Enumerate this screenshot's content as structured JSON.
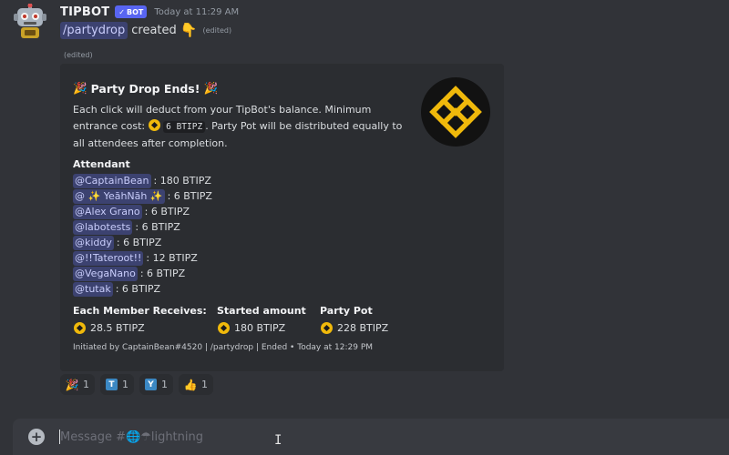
{
  "message": {
    "username": "TIPBOT",
    "bot_tag": "BOT",
    "timestamp": "Today at 11:29 AM",
    "command": "/partydrop",
    "created_text": "created",
    "edited_label": "(edited)"
  },
  "embed": {
    "title": "Party Drop Ends!",
    "description_part1": "Each click will deduct from your TipBot's balance. Minimum entrance cost:",
    "min_cost": "6 BTIPZ",
    "description_part2": ". Party Pot will be distributed equally to all attendees after completion.",
    "attendee_label": "Attendant",
    "attendees": [
      {
        "name": "@CaptainBean",
        "amount": ": 180 BTIPZ"
      },
      {
        "name": "@ ✨ YeāhNāh ✨",
        "amount": ": 6 BTIPZ"
      },
      {
        "name": "@Alex Grano",
        "amount": ": 6 BTIPZ"
      },
      {
        "name": "@labotests",
        "amount": ": 6 BTIPZ"
      },
      {
        "name": "@kiddy",
        "amount": ": 6 BTIPZ"
      },
      {
        "name": "@!!Tateroot!!",
        "amount": ": 12 BTIPZ"
      },
      {
        "name": "@VegaNano",
        "amount": ": 6 BTIPZ"
      },
      {
        "name": "@tutak",
        "amount": ": 6 BTIPZ"
      }
    ],
    "fields": [
      {
        "label": "Each Member Receives:",
        "value": "28.5 BTIPZ"
      },
      {
        "label": "Started amount",
        "value": "180 BTIPZ"
      },
      {
        "label": "Party Pot",
        "value": "228 BTIPZ"
      }
    ],
    "footer": "Initiated by CaptainBean#4520 | /partydrop | Ended • Today at 12:29 PM",
    "thumbnail_icon": "binance-logo",
    "coin_color": "#f0b90b"
  },
  "reactions": [
    {
      "icon": "party-popper",
      "count": "1"
    },
    {
      "icon": "T",
      "count": "1"
    },
    {
      "icon": "Y",
      "count": "1"
    },
    {
      "icon": "thumbs-up",
      "count": "1"
    }
  ],
  "composer": {
    "placeholder": "Message #🌐☂lightning"
  }
}
